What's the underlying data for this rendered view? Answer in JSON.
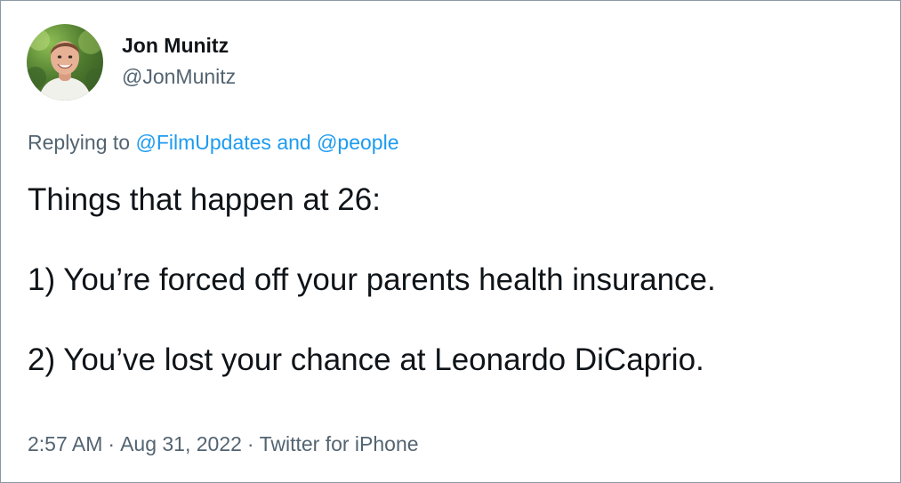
{
  "user": {
    "display_name": "Jon Munitz",
    "handle": "@JonMunitz"
  },
  "reply": {
    "prefix": "Replying to",
    "mention_1": "@FilmUpdates",
    "conjunction": "and",
    "mention_2": "@people"
  },
  "tweet": {
    "line_1": "Things that happen at 26:",
    "line_2": "1) You’re forced off your parents health insurance.",
    "line_3": "2) You’ve lost your chance at Leonardo DiCaprio."
  },
  "meta": {
    "time": "2:57 AM",
    "separator": "·",
    "date": "Aug 31, 2022",
    "source": "Twitter for iPhone"
  },
  "colors": {
    "text": "#0f1419",
    "secondary": "#536471",
    "link": "#1d9bf0",
    "border": "#8b98a5"
  },
  "icons": {
    "avatar": "profile-photo"
  }
}
